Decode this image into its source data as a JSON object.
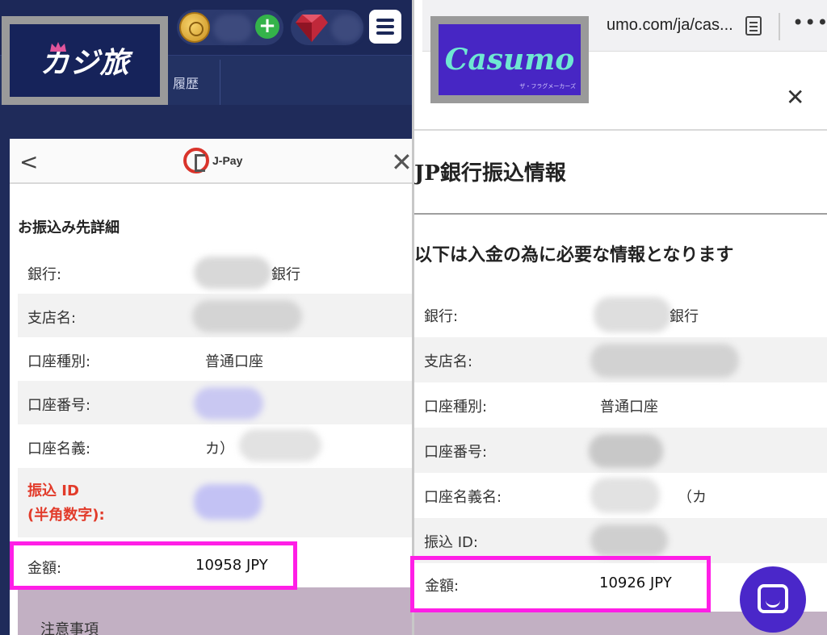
{
  "left": {
    "logo_text": "カジ旅",
    "coin_add_symbol": "+",
    "nav_history": "履歴",
    "dialog": {
      "back_symbol": "<",
      "close_symbol": "✕",
      "brand": "J-Pay",
      "title": "お振込み先詳細",
      "rows": [
        {
          "label": "銀行:",
          "value": "銀行"
        },
        {
          "label": "支店名:",
          "value": ""
        },
        {
          "label": "口座種別:",
          "value": "普通口座"
        },
        {
          "label": "口座番号:",
          "value": ""
        },
        {
          "label": "口座名義:",
          "value": "カ）"
        }
      ],
      "transfer_id_label_1": "振込 ID",
      "transfer_id_label_2": "(半角数字):",
      "amount_label": "金額:",
      "amount_value": "10958 JPY",
      "notes_label": "注意事項"
    },
    "colors": {
      "header": "#1c2858",
      "highlight": "#ff1ee6",
      "alert": "#e23b2a"
    }
  },
  "right": {
    "url": "umo.com/ja/cas...",
    "more_symbol": "•••",
    "logo_text": "Casumo",
    "logo_sub": "ザ・フラグメーカーズ",
    "close_symbol": "✕",
    "title": "JP銀行振込情報",
    "subtitle": "以下は入金の為に必要な情報となります",
    "rows": [
      {
        "label": "銀行:",
        "value": "銀行"
      },
      {
        "label": "支店名:",
        "value": ""
      },
      {
        "label": "口座種別:",
        "value": "普通口座"
      },
      {
        "label": "口座番号:",
        "value": ""
      },
      {
        "label": "口座名義名:",
        "value": "（カ"
      },
      {
        "label": "振込 ID:",
        "value": ""
      }
    ],
    "amount_label": "金額:",
    "amount_value": "10926 JPY",
    "colors": {
      "brand": "#4726c4",
      "logo_text": "#6fe7d2"
    }
  }
}
